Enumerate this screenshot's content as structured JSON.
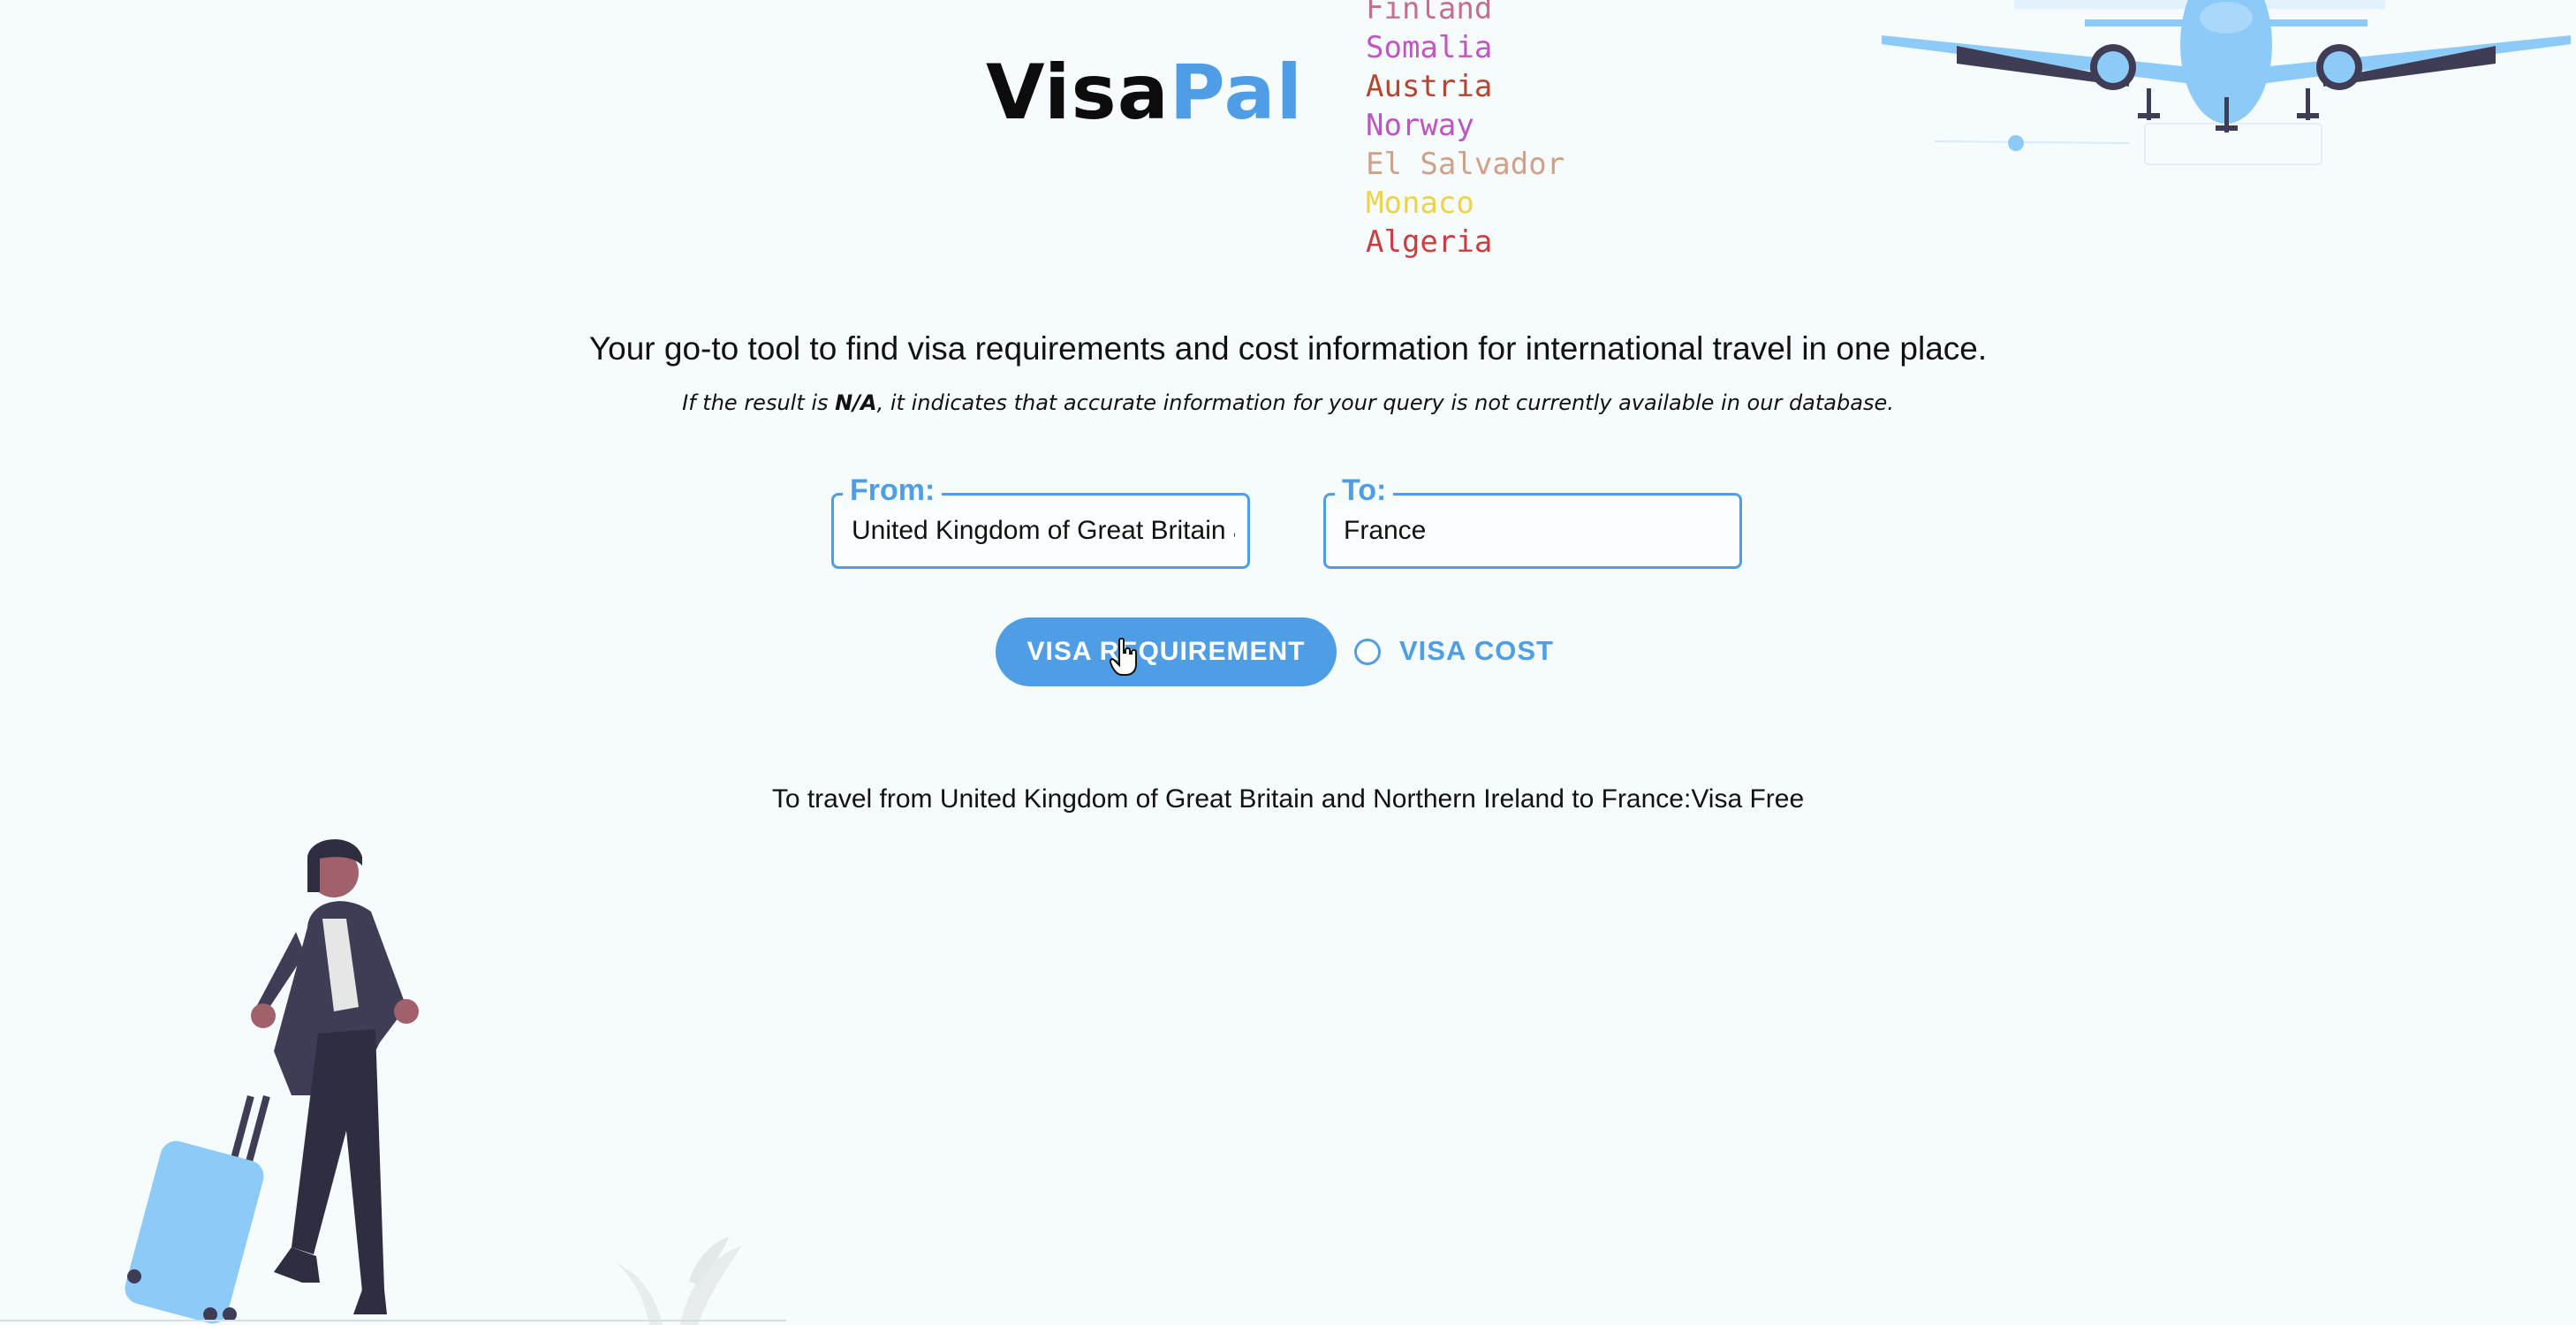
{
  "header": {
    "logo_part1": "Visa",
    "logo_part2": "Pal",
    "logo_colors": {
      "visa": "#0c0c0c",
      "pal": "#4f9ee5"
    },
    "rotating_countries": [
      {
        "name": "Finland",
        "color": "#c76e8c"
      },
      {
        "name": "Somalia",
        "color": "#c453c6"
      },
      {
        "name": "Austria",
        "color": "#b4462f"
      },
      {
        "name": "Norway",
        "color": "#bd55c2"
      },
      {
        "name": "El Salvador",
        "color": "#d0a187"
      },
      {
        "name": "Monaco",
        "color": "#eed24a"
      },
      {
        "name": "Algeria",
        "color": "#c93f3f"
      }
    ]
  },
  "main": {
    "tagline": "Your go-to tool to find visa requirements and cost information for international travel in one place.",
    "note_prefix": "If the result is ",
    "note_bold": "N/A",
    "note_suffix": ", it indicates that accurate information for your query is not currently available in our database.",
    "from_label": "From:",
    "from_value": "United Kingdom of Great Britain and Northern Ireland",
    "to_label": "To:",
    "to_value": "France",
    "requirement_button": "VISA REQUIREMENT",
    "cost_option": "VISA COST",
    "result_text": "To travel from United Kingdom of Great Britain and Northern Ireland to France:Visa Free"
  },
  "colors": {
    "accent": "#4f9ee5",
    "background": "#f6fcfd",
    "plane": "#8ccbf7"
  },
  "icons": [
    "airplane-icon",
    "cursor-hand-icon",
    "traveler-illustration",
    "suitcase-icon",
    "plant-icon"
  ]
}
